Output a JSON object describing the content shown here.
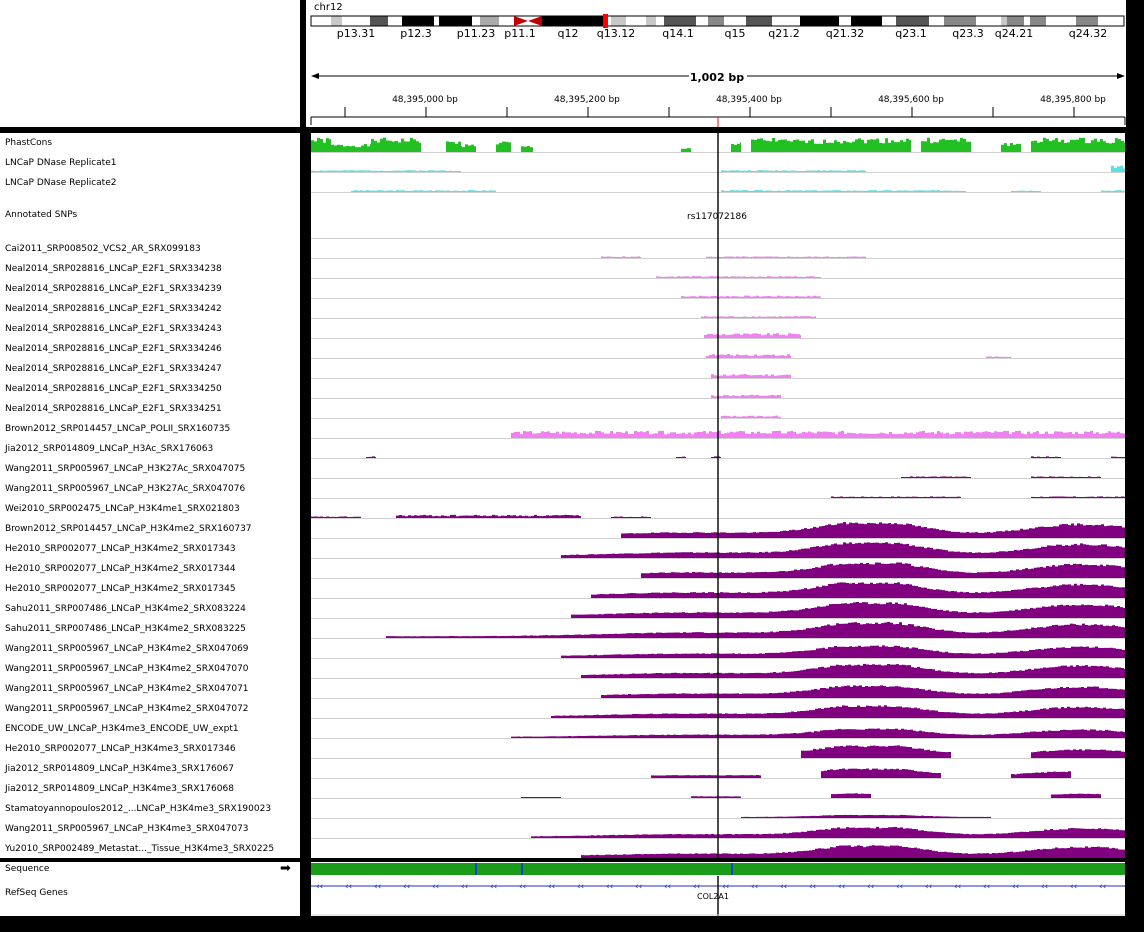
{
  "header": {
    "chrom": "chr12",
    "bands": [
      "p13.31",
      "p12.3",
      "p11.23",
      "p11.1",
      "q12",
      "q13.12",
      "q14.1",
      "q15",
      "q21.2",
      "q21.32",
      "q23.1",
      "q23.3",
      "q24.21",
      "q24.32"
    ],
    "span_label": "1,002 bp",
    "ticks": [
      "48,395,000 bp",
      "48,395,200 bp",
      "48,395,400 bp",
      "48,395,600 bp",
      "48,395,800 bp"
    ]
  },
  "tracks": [
    {
      "name": "PhastCons",
      "color": "#22c022"
    },
    {
      "name": "LNCaP DNase Replicate1",
      "color": "#5fe0e0"
    },
    {
      "name": "LNCaP DNase Replicate2",
      "color": "#5fe0e0"
    },
    {
      "name": "Annotated SNPs",
      "color": "#000000"
    },
    {
      "name": "Cai2011_SRP008502_VCS2_AR_SRX099183",
      "color": "#ee82ee"
    },
    {
      "name": "Neal2014_SRP028816_LNCaP_E2F1_SRX334238",
      "color": "#ee82ee"
    },
    {
      "name": "Neal2014_SRP028816_LNCaP_E2F1_SRX334239",
      "color": "#ee82ee"
    },
    {
      "name": "Neal2014_SRP028816_LNCaP_E2F1_SRX334242",
      "color": "#ee82ee"
    },
    {
      "name": "Neal2014_SRP028816_LNCaP_E2F1_SRX334243",
      "color": "#ee82ee"
    },
    {
      "name": "Neal2014_SRP028816_LNCaP_E2F1_SRX334246",
      "color": "#ee82ee"
    },
    {
      "name": "Neal2014_SRP028816_LNCaP_E2F1_SRX334247",
      "color": "#ee82ee"
    },
    {
      "name": "Neal2014_SRP028816_LNCaP_E2F1_SRX334250",
      "color": "#ee82ee"
    },
    {
      "name": "Neal2014_SRP028816_LNCaP_E2F1_SRX334251",
      "color": "#ee82ee"
    },
    {
      "name": "Brown2012_SRP014457_LNCaP_POLII_SRX160735",
      "color": "#ee82ee"
    },
    {
      "name": "Jia2012_SRP014809_LNCaP_H3Ac_SRX176063",
      "color": "#800080"
    },
    {
      "name": "Wang2011_SRP005967_LNCaP_H3K27Ac_SRX047075",
      "color": "#800080"
    },
    {
      "name": "Wang2011_SRP005967_LNCaP_H3K27Ac_SRX047076",
      "color": "#800080"
    },
    {
      "name": "Wei2010_SRP002475_LNCaP_H3K4me1_SRX021803",
      "color": "#800080"
    },
    {
      "name": "Brown2012_SRP014457_LNCaP_H3K4me2_SRX160737",
      "color": "#800080"
    },
    {
      "name": "He2010_SRP002077_LNCaP_H3K4me2_SRX017343",
      "color": "#800080"
    },
    {
      "name": "He2010_SRP002077_LNCaP_H3K4me2_SRX017344",
      "color": "#800080"
    },
    {
      "name": "He2010_SRP002077_LNCaP_H3K4me2_SRX017345",
      "color": "#800080"
    },
    {
      "name": "Sahu2011_SRP007486_LNCaP_H3K4me2_SRX083224",
      "color": "#800080"
    },
    {
      "name": "Sahu2011_SRP007486_LNCaP_H3K4me2_SRX083225",
      "color": "#800080"
    },
    {
      "name": "Wang2011_SRP005967_LNCaP_H3K4me2_SRX047069",
      "color": "#800080"
    },
    {
      "name": "Wang2011_SRP005967_LNCaP_H3K4me2_SRX047070",
      "color": "#800080"
    },
    {
      "name": "Wang2011_SRP005967_LNCaP_H3K4me2_SRX047071",
      "color": "#800080"
    },
    {
      "name": "Wang2011_SRP005967_LNCaP_H3K4me2_SRX047072",
      "color": "#800080"
    },
    {
      "name": "ENCODE_UW_LNCaP_H3K4me3_ENCODE_UW_expt1",
      "color": "#800080"
    },
    {
      "name": "He2010_SRP002077_LNCaP_H3K4me3_SRX017346",
      "color": "#800080"
    },
    {
      "name": "Jia2012_SRP014809_LNCaP_H3K4me3_SRX176067",
      "color": "#800080"
    },
    {
      "name": "Jia2012_SRP014809_LNCaP_H3K4me3_SRX176068",
      "color": "#800080"
    },
    {
      "name": "Stamatoyannopoulos2012_...LNCaP_H3K4me3_SRX190023",
      "color": "#800080"
    },
    {
      "name": "Wang2011_SRP005967_LNCaP_H3K4me3_SRX047073",
      "color": "#800080"
    },
    {
      "name": "Yu2010_SRP002489_Metastat..._Tissue_H3K4me3_SRX0225",
      "color": "#800080"
    }
  ],
  "snp_label": "rs117072186",
  "bottom": {
    "sequence_label": "Sequence",
    "sequence_arrow": "➡",
    "refseq_label": "RefSeq Genes",
    "gene_name": "COL2A1",
    "strand_glyph": "‹‹"
  }
}
